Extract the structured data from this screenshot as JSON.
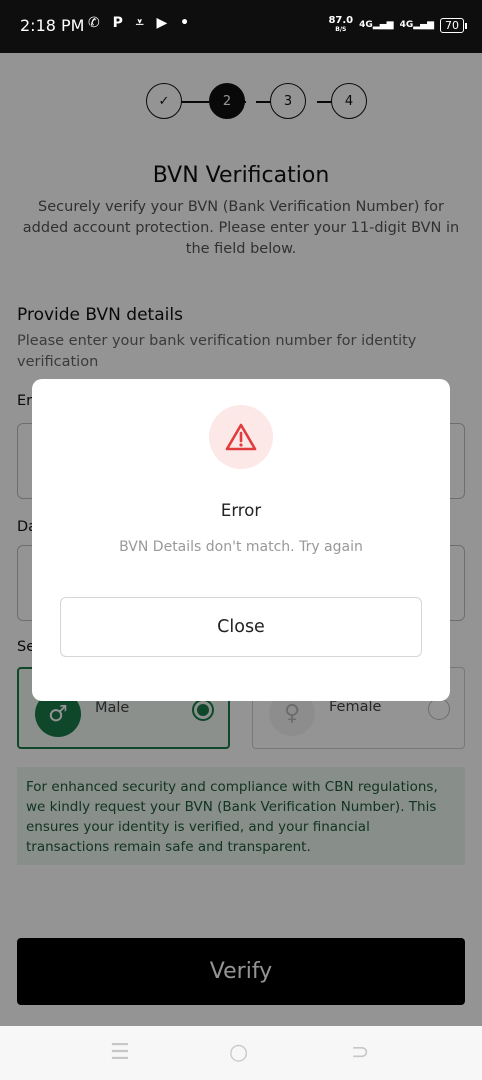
{
  "status_bar": {
    "time": "2:18 PM",
    "notification_icons": "✆ P ⩡ ▶ •",
    "net_speed_value": "87.0",
    "net_speed_unit": "B/S",
    "signal_1": "4G",
    "signal_2": "4G",
    "battery": "70"
  },
  "stepper": {
    "steps": [
      {
        "label": "✓",
        "state": "done"
      },
      {
        "label": "2",
        "state": "active"
      },
      {
        "label": "3",
        "state": "pending"
      },
      {
        "label": "4",
        "state": "pending"
      }
    ]
  },
  "header": {
    "title": "BVN Verification",
    "subtitle": "Securely verify your BVN (Bank Verification Number) for added account protection. Please enter your 11-digit BVN in the field below."
  },
  "form": {
    "section_title": "Provide BVN details",
    "section_desc": "Please enter your bank verification number for identity verification",
    "field_1_label": "Er",
    "field_2_label": "Da",
    "field_3_label": "Se",
    "gender": {
      "male_label": "Male",
      "female_label": "Female",
      "selected": "Male"
    }
  },
  "notice": {
    "text": "For enhanced security and compliance with CBN regulations, we kindly request your BVN (Bank Verification Number). This ensures your identity is verified, and your financial transactions remain safe and transparent."
  },
  "verify_label": "Verify",
  "modal": {
    "title": "Error",
    "message": "BVN Details don't match. Try again",
    "close_label": "Close"
  },
  "colors": {
    "brand_green": "#1a7a4a",
    "error_red": "#e03c3c",
    "error_bg": "#fde8e8"
  }
}
